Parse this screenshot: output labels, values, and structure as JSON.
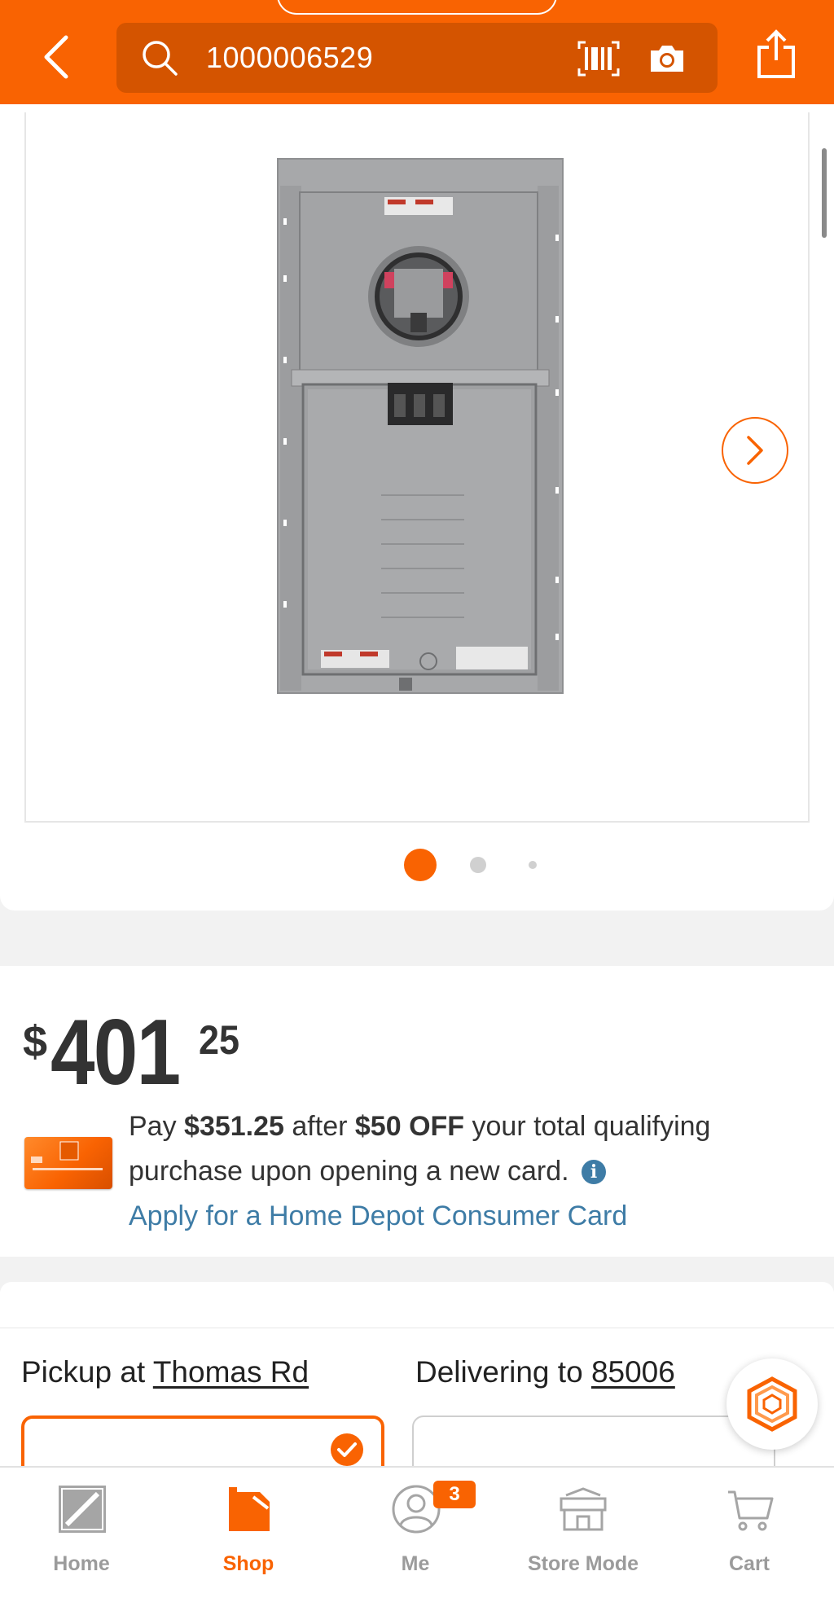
{
  "header": {
    "search_query": "1000006529",
    "back_icon": "chevron-left-icon",
    "search_icon": "search-icon",
    "barcode_icon": "barcode-icon",
    "camera_icon": "camera-icon",
    "share_icon": "share-icon",
    "brand_color": "#f96302"
  },
  "gallery": {
    "dots_count": 3,
    "active_dot": 0
  },
  "price": {
    "currency": "$",
    "dollars": "401",
    "cents": "25"
  },
  "promo": {
    "text_1": "Pay ",
    "amount": "$351.25",
    "text_2": " after ",
    "discount": "$50 OFF",
    "text_3": " your total qualifying purchase upon opening a new card.",
    "info_glyph": "i",
    "apply_link": "Apply for a Home Depot Consumer Card"
  },
  "fulfillment": {
    "pickup_prefix": "Pickup at ",
    "pickup_store": "Thomas Rd",
    "delivery_prefix": "Delivering to ",
    "delivery_zip": "85006"
  },
  "bottom_nav": {
    "items": [
      {
        "label": "Home",
        "icon": "home-depot-logo-icon"
      },
      {
        "label": "Shop",
        "icon": "shop-icon"
      },
      {
        "label": "Me",
        "icon": "user-icon"
      },
      {
        "label": "Store Mode",
        "icon": "store-icon"
      },
      {
        "label": "Cart",
        "icon": "cart-icon"
      }
    ],
    "me_badge": "3",
    "active": "Shop"
  }
}
